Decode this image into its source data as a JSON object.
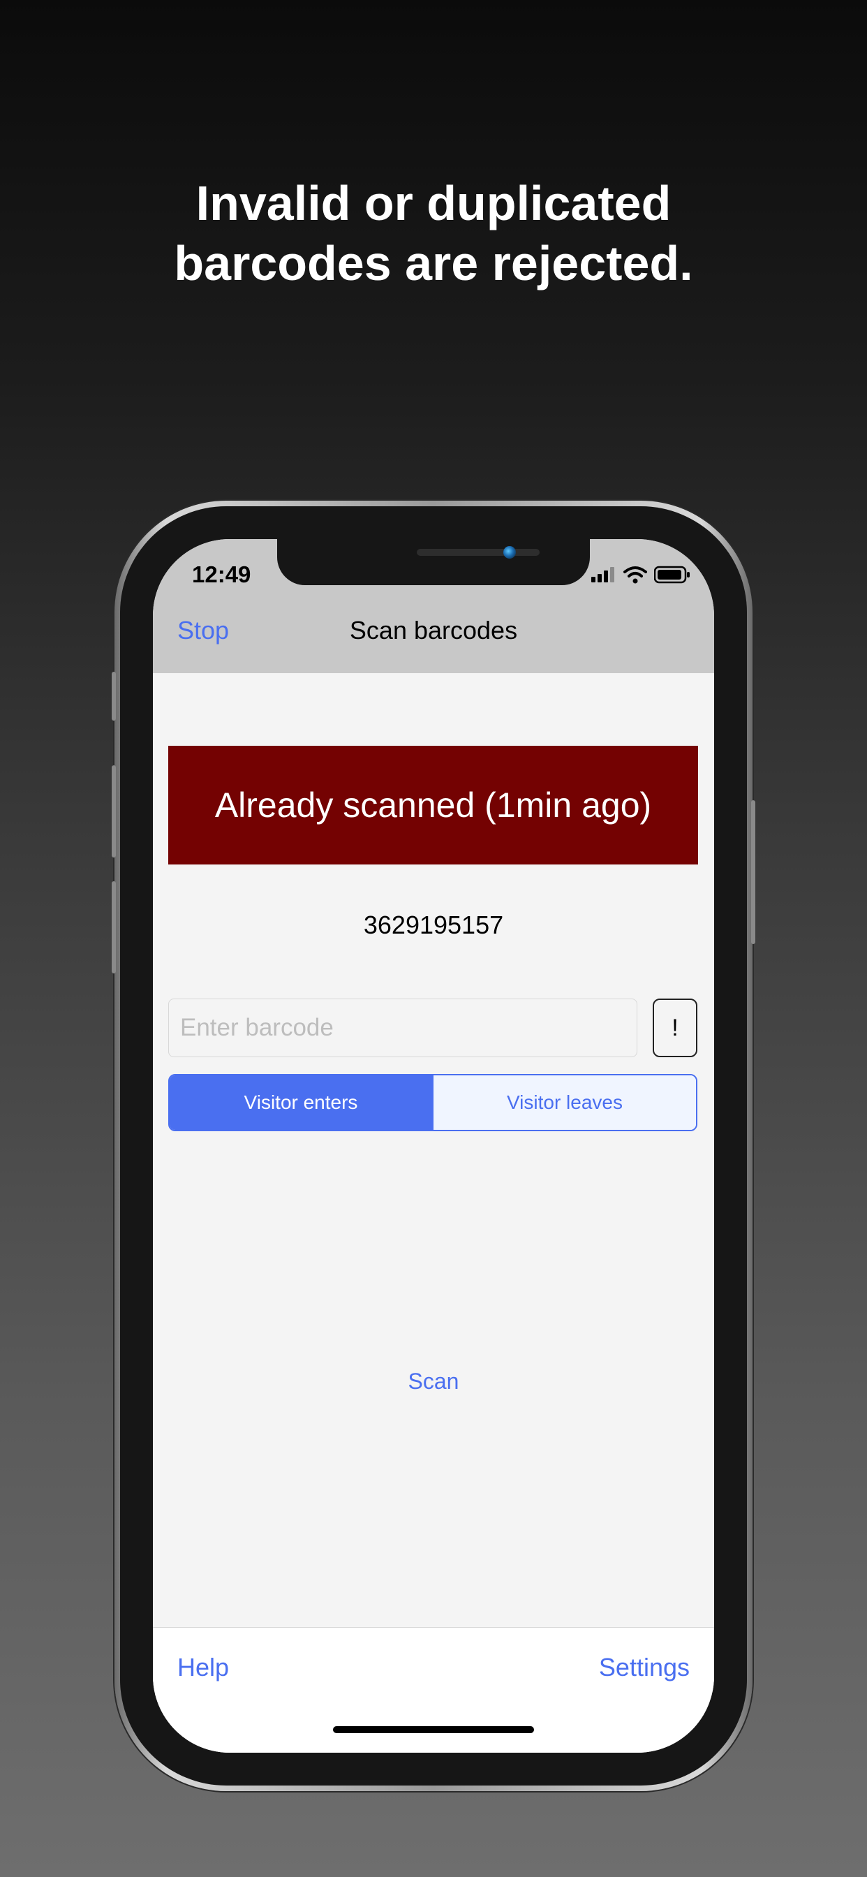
{
  "headline": {
    "line1": "Invalid or duplicated",
    "line2": "barcodes are rejected."
  },
  "status_bar": {
    "time": "12:49",
    "icons": [
      "cellular-signal-icon",
      "wifi-icon",
      "battery-icon"
    ]
  },
  "nav": {
    "left_button": "Stop",
    "title": "Scan barcodes"
  },
  "alert": {
    "message": "Already scanned (1min ago)",
    "color": "#740202"
  },
  "scanned_code": "3629195157",
  "barcode_input": {
    "value": "",
    "placeholder": "Enter barcode"
  },
  "manual_button_label": "!",
  "direction_segment": {
    "options": [
      "Visitor enters",
      "Visitor leaves"
    ],
    "selected": "Visitor enters"
  },
  "scan_label": "Scan",
  "toolbar": {
    "help": "Help",
    "settings": "Settings"
  },
  "colors": {
    "accent": "#4a6ff0",
    "nav_bg": "#c8c8c8"
  }
}
